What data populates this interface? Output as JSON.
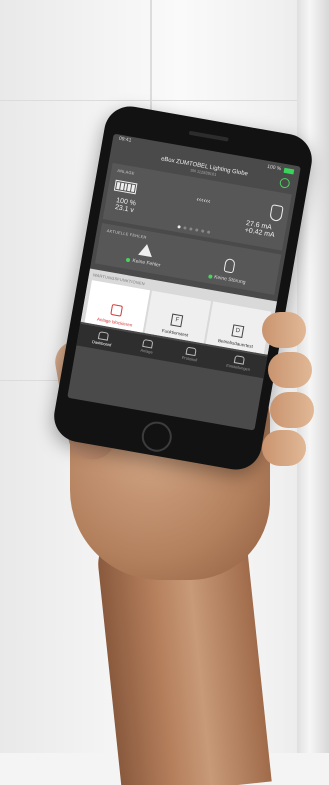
{
  "status": {
    "time": "09:41",
    "battery": "100 %"
  },
  "header": {
    "title": "eBox ZUMTOBEL Lighting Globe",
    "subtitle": "SN 112839101"
  },
  "anlage": {
    "label": "ANLAGE",
    "left_values": [
      "100 %",
      "23.1 v"
    ],
    "right_values": [
      "27.6 mA",
      "+0.42 mA"
    ]
  },
  "faults": {
    "label": "AKTUELLE FEHLER",
    "left_status": "Keine Fehler",
    "right_status": "Keine Störung"
  },
  "maintenance": {
    "label": "WARTUNGSFUNKTIONEN",
    "buttons": [
      "Anlage blockieren",
      "Funktionstest",
      "Betriebsdauertest"
    ]
  },
  "tabs": [
    "Dashboard",
    "Anlage",
    "Protokoll",
    "Einstellungen"
  ],
  "colors": {
    "accent_green": "#47d35e",
    "accent_red": "#d23c3c"
  }
}
